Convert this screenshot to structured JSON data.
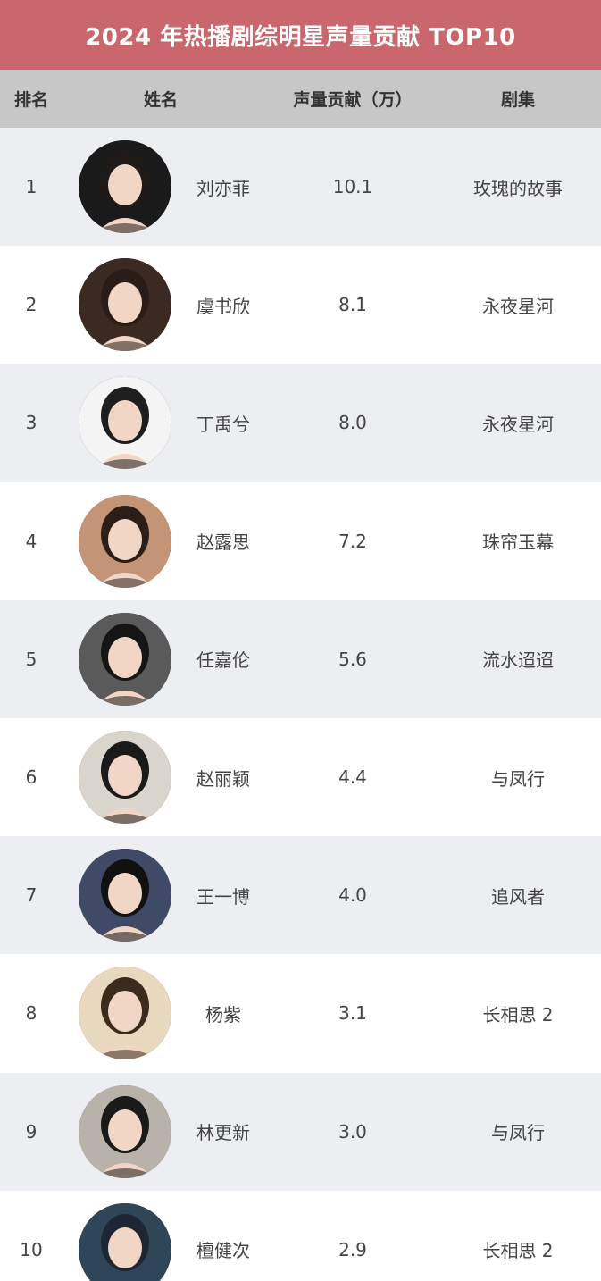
{
  "header": {
    "title": "2024 年热播剧综明星声量贡献 TOP10"
  },
  "columns": {
    "rank": "排名",
    "name": "姓名",
    "score": "声量贡献（万）",
    "drama": "剧集"
  },
  "rows": [
    {
      "rank": "1",
      "name": "刘亦菲",
      "score": "10.1",
      "drama": "玫瑰的故事",
      "bg": "#1a1a1a",
      "hair": "#1f1a17"
    },
    {
      "rank": "2",
      "name": "虞书欣",
      "score": "8.1",
      "drama": "永夜星河",
      "bg": "#3a2a22",
      "hair": "#2a1c16"
    },
    {
      "rank": "3",
      "name": "丁禹兮",
      "score": "8.0",
      "drama": "永夜星河",
      "bg": "#f4f4f4",
      "hair": "#1e1e1e"
    },
    {
      "rank": "4",
      "name": "赵露思",
      "score": "7.2",
      "drama": "珠帘玉幕",
      "bg": "#c49477",
      "hair": "#2b1d17"
    },
    {
      "rank": "5",
      "name": "任嘉伦",
      "score": "5.6",
      "drama": "流水迢迢",
      "bg": "#5a5a5a",
      "hair": "#151515"
    },
    {
      "rank": "6",
      "name": "赵丽颖",
      "score": "4.4",
      "drama": "与凤行",
      "bg": "#d9d4cc",
      "hair": "#1a1a1a"
    },
    {
      "rank": "7",
      "name": "王一博",
      "score": "4.0",
      "drama": "追风者",
      "bg": "#3f4a66",
      "hair": "#111111"
    },
    {
      "rank": "8",
      "name": "杨紫",
      "score": "3.1",
      "drama": "长相思 2",
      "bg": "#e8d8bd",
      "hair": "#3a2b1c"
    },
    {
      "rank": "9",
      "name": "林更新",
      "score": "3.0",
      "drama": "与凤行",
      "bg": "#b8b2ab",
      "hair": "#1a1a1a"
    },
    {
      "rank": "10",
      "name": "檀健次",
      "score": "2.9",
      "drama": "长相思 2",
      "bg": "#2f4658",
      "hair": "#1c2733"
    }
  ]
}
